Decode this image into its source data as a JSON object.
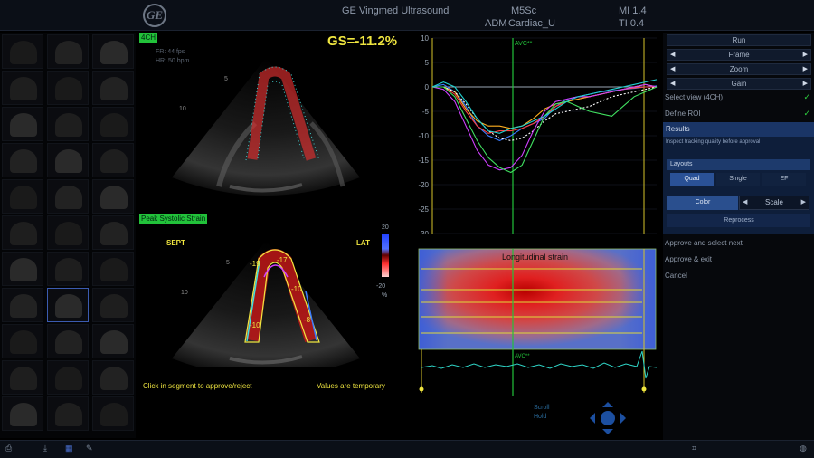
{
  "header": {
    "system_name": "GE Vingmed Ultrasound",
    "probe": "M5Sc",
    "adm": "ADM",
    "preset": "Cardiac_U",
    "mi": "MI 1.4",
    "ti": "TI 0.4"
  },
  "echo": {
    "view_tag": "4CH",
    "fr": "FR: 44 fps",
    "hr": "HR: 50 bpm",
    "gs": "GS=-11.2%",
    "depth_5_top": "5",
    "depth_10_top": "10",
    "mode_tag": "Peak Systolic Strain",
    "sept": "SEPT",
    "lat": "LAT",
    "depth_5_bottom": "5",
    "depth_10_bottom": "10",
    "scale_max": "20",
    "scale_min": "-20",
    "scale_unit": "%",
    "segments": [
      "-19",
      "-17",
      "-10",
      "-8",
      "-10"
    ],
    "instruction_left": "Click in segment to approve/reject",
    "instruction_right": "Values are temporary"
  },
  "graph": {
    "avc_label": "AVC**",
    "y_ticks": [
      "10",
      "5",
      "0",
      "-5",
      "-10",
      "-15",
      "-20",
      "-25",
      "-30"
    ]
  },
  "map": {
    "title": "Longitudinal strain",
    "avc_label": "AVC**"
  },
  "trackball": {
    "label_top": "Scroll",
    "label_bottom": "Hold"
  },
  "panel": {
    "run": "Run",
    "frame": "Frame",
    "zoom": "Zoom",
    "gain": "Gain",
    "select_view": "Select view (4CH)",
    "define_roi": "Define ROI",
    "results": "Results",
    "results_sub": "Inspect tracking quality before approval",
    "layouts": "Layouts",
    "layout_quad": "Quad",
    "layout_single": "Single",
    "layout_ef": "EF",
    "color": "Color",
    "scale": "Scale",
    "reprocess": "Reprocess",
    "approve_next": "Approve and select next",
    "approve_exit": "Approve & exit",
    "cancel": "Cancel"
  },
  "colors": {
    "accent_blue": "#2a5196",
    "check_green": "#2fd23f",
    "overlay_yellow": "#f0e640",
    "avc_green": "#22c23a"
  },
  "chart_data": {
    "type": "line",
    "title": "",
    "xlabel": "",
    "ylabel": "",
    "ylim": [
      -30,
      10
    ],
    "y_ticks": [
      10,
      5,
      0,
      -5,
      -10,
      -15,
      -20,
      -25,
      -30
    ],
    "x": [
      0,
      1,
      2,
      3,
      4,
      5,
      6,
      7,
      8,
      9,
      10,
      11,
      12,
      13,
      14,
      15,
      16,
      17,
      18,
      19,
      20
    ],
    "series": [
      {
        "color": "#3b7cff",
        "values": [
          0,
          0.5,
          -1,
          -4,
          -8,
          -10,
          -11,
          -10,
          -8.5,
          -7.5,
          -6.5,
          -4,
          -2.5,
          -2,
          -1.5,
          -1,
          -0.8,
          -0.5,
          -0.3,
          0,
          0.2
        ]
      },
      {
        "color": "#ff4040",
        "values": [
          0,
          0,
          -1.5,
          -5,
          -8,
          -9.5,
          -9,
          -9,
          -8.5,
          -7.5,
          -6,
          -4,
          -3,
          -2.5,
          -2,
          -1.5,
          -1,
          -0.5,
          -0.2,
          0,
          0
        ]
      },
      {
        "color": "#ffb020",
        "values": [
          0,
          0,
          -1,
          -4.5,
          -7,
          -8,
          -8,
          -8.5,
          -8,
          -6.5,
          -4.5,
          -3.5,
          -3,
          -2.5,
          -2,
          -1.5,
          -1,
          -0.5,
          0,
          0.5,
          0
        ]
      },
      {
        "color": "#ffffff",
        "dashed": true,
        "values": [
          0,
          0,
          -1,
          -3.5,
          -6.5,
          -9,
          -10.5,
          -11,
          -10.5,
          -9,
          -7,
          -5.5,
          -5,
          -4.5,
          -4,
          -3,
          -2,
          -1.5,
          -1,
          -0.5,
          0
        ]
      },
      {
        "color": "#d040ff",
        "values": [
          0,
          -0.5,
          -3,
          -8,
          -13,
          -16,
          -17,
          -16.5,
          -14,
          -9,
          -5,
          -3,
          -2.5,
          -2,
          -2,
          -1.5,
          -1,
          -0.5,
          0,
          0.5,
          0
        ]
      },
      {
        "color": "#40e060",
        "values": [
          0,
          0,
          -2,
          -6.5,
          -11,
          -14.5,
          -16.5,
          -17.5,
          -16,
          -11,
          -6,
          -3.5,
          -3,
          -4,
          -5,
          -5.5,
          -6,
          -4,
          -2,
          -1,
          0
        ]
      },
      {
        "color": "#20d0d0",
        "values": [
          0,
          1,
          0,
          -3,
          -6.5,
          -9,
          -9.5,
          -8.5,
          -8,
          -7,
          -6,
          -4.5,
          -3,
          -2,
          -1.5,
          -1,
          -0.5,
          0,
          0.5,
          1,
          1.5
        ]
      }
    ]
  }
}
